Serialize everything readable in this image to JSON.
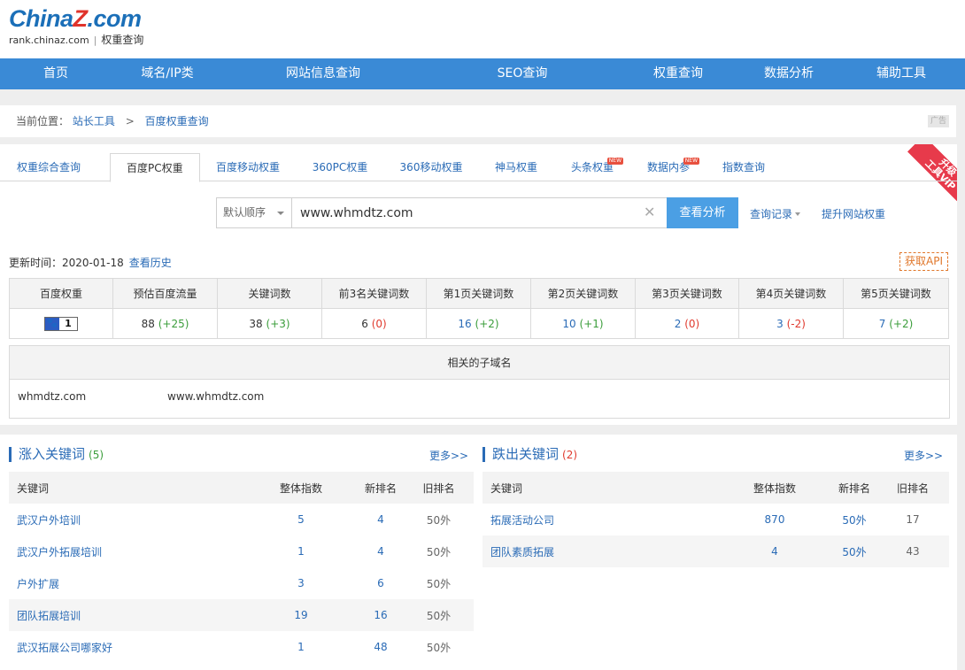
{
  "logo": {
    "brand_a": "China",
    "brand_z": "Z",
    "brand_b": ".com",
    "domain": "rank.chinaz.com",
    "sep": "|",
    "tagline": "权重查询"
  },
  "nav": [
    "首页",
    "域名/IP类",
    "网站信息查询",
    "SEO查询",
    "权重查询",
    "数据分析",
    "辅助工具"
  ],
  "breadcrumb": {
    "prefix": "当前位置：",
    "sep": ">",
    "items": [
      "站长工具",
      "百度权重查询"
    ],
    "ad": "广告"
  },
  "vip": {
    "line1": "升级",
    "line2": "工具VIP"
  },
  "tabs": [
    {
      "label": "权重综合查询"
    },
    {
      "label": "百度PC权重"
    },
    {
      "label": "百度移动权重"
    },
    {
      "label": "360PC权重"
    },
    {
      "label": "360移动权重"
    },
    {
      "label": "神马权重"
    },
    {
      "label": "头条权重",
      "badge": "NEW"
    },
    {
      "label": "数据内参",
      "badge": "NEW"
    },
    {
      "label": "指数查询"
    }
  ],
  "search": {
    "order": "默认顺序",
    "value": "www.whmdtz.com",
    "button": "查看分析",
    "history": "查询记录",
    "improve": "提升网站权重"
  },
  "update": {
    "label": "更新时间：2020-01-18",
    "history": "查看历史",
    "api": "获取API"
  },
  "stats": {
    "headers": [
      "百度权重",
      "预估百度流量",
      "关键词数",
      "前3名关键词数",
      "第1页关键词数",
      "第2页关键词数",
      "第3页关键词数",
      "第4页关键词数",
      "第5页关键词数"
    ],
    "rank": "1",
    "values": [
      {
        "v": "88",
        "d": "(+25)"
      },
      {
        "v": "38",
        "d": "(+3)"
      },
      {
        "v": "6",
        "d": "(0)"
      },
      {
        "v": "16",
        "d": "(+2)"
      },
      {
        "v": "10",
        "d": "(+1)"
      },
      {
        "v": "2",
        "d": "(0)"
      },
      {
        "v": "3",
        "d": "(-2)"
      },
      {
        "v": "7",
        "d": "(+2)"
      }
    ]
  },
  "subdomains": {
    "title": "相关的子域名",
    "items": [
      "whmdtz.com",
      "www.whmdtz.com"
    ]
  },
  "rising": {
    "title": "涨入关键词",
    "count": "(5)",
    "more": "更多>>",
    "headers": [
      "关键词",
      "整体指数",
      "新排名",
      "旧排名"
    ],
    "rows": [
      [
        "武汉户外培训",
        "5",
        "4",
        "50外"
      ],
      [
        "武汉户外拓展培训",
        "1",
        "4",
        "50外"
      ],
      [
        "户外扩展",
        "3",
        "6",
        "50外"
      ],
      [
        "团队拓展培训",
        "19",
        "16",
        "50外"
      ],
      [
        "武汉拓展公司哪家好",
        "1",
        "48",
        "50外"
      ]
    ]
  },
  "falling": {
    "title": "跌出关键词",
    "count": "(2)",
    "more": "更多>>",
    "headers": [
      "关键词",
      "整体指数",
      "新排名",
      "旧排名"
    ],
    "rows": [
      [
        "拓展活动公司",
        "870",
        "50外",
        "17"
      ],
      [
        "团队素质拓展",
        "4",
        "50外",
        "43"
      ]
    ]
  }
}
